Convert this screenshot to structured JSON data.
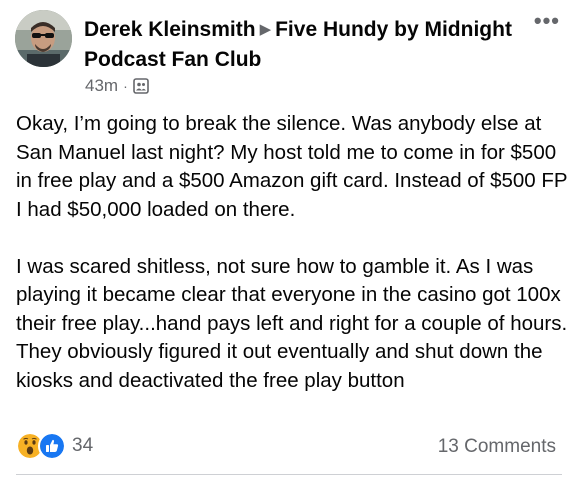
{
  "post": {
    "author": "Derek Kleinsmith",
    "group": "Five Hundy by Midnight Podcast Fan Club",
    "time": "43m",
    "separator": "·",
    "audience_icon": "group-members-icon",
    "more_label": "•••",
    "paragraphs": [
      "Okay, I’m going to break the silence. Was anybody else at San Manuel last night? My host told me to come in for $500 in free play and a $500 Amazon gift card. Instead of $500 FP I had $50,000 loaded on there.",
      "I was scared shitless, not sure how to gamble it. As I was playing it became clear that everyone in the casino got 100x their free play...hand pays left and right for a couple of hours. They obviously figured it out eventually and shut down the kiosks and deactivated the free play button"
    ],
    "reactions": {
      "icons": [
        "wow-reaction-icon",
        "like-reaction-icon"
      ],
      "count": "34"
    },
    "comments_label": "13 Comments"
  },
  "colors": {
    "primary_text": "#050505",
    "secondary_text": "#65676b",
    "like_blue": "#1877f2",
    "wow_yellow": "#f7b125",
    "divider": "#ced0d4"
  }
}
